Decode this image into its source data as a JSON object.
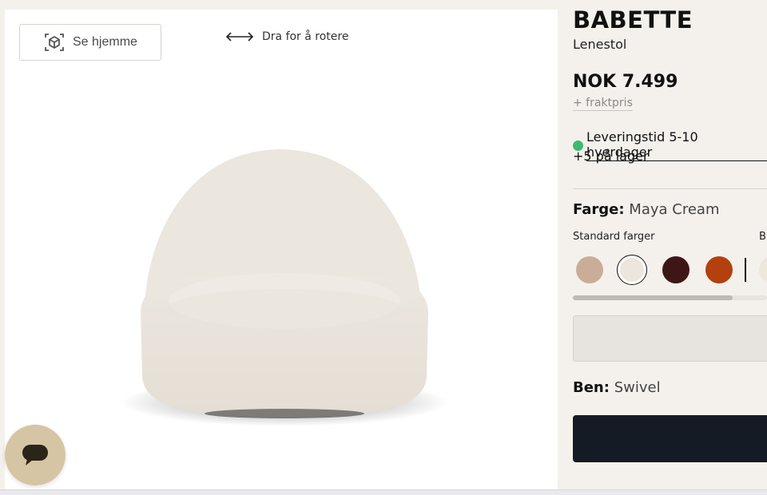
{
  "viewer": {
    "see_home_label": "Se hjemme",
    "see_home_icon": "ar-cube-icon",
    "rotate_label": "Dra for å rotere",
    "rotate_icon": "horizontal-arrows-icon"
  },
  "product": {
    "name": "BABETTE",
    "type": "Lenestol",
    "price": "NOK 7.499",
    "shipping": "+ fraktpris",
    "delivery": "Leveringstid 5-10 hverdager",
    "stock": "+5 på lager",
    "color_label": "Farge:",
    "color_value": "Maya Cream",
    "standard_colors_label": "Standard farger",
    "more_colors_label_partial": "B",
    "swatches": [
      {
        "name": "beige",
        "color": "#c9ad98"
      },
      {
        "name": "maya-cream",
        "color": "#ece6dd",
        "selected": true
      },
      {
        "name": "dark-brown",
        "color": "#3e1616"
      },
      {
        "name": "rust",
        "color": "#b4400f"
      },
      {
        "name": "light-cream-partial",
        "color": "#ede7dc"
      }
    ],
    "legs_label": "Ben:",
    "legs_value": "Swivel"
  },
  "colors": {
    "background": "#f4f1ec",
    "cta": "#151b25",
    "delivery_dot": "#3dba6f",
    "chat_button": "#d6c5a4"
  },
  "chat": {
    "icon": "chat-bubble-icon"
  }
}
